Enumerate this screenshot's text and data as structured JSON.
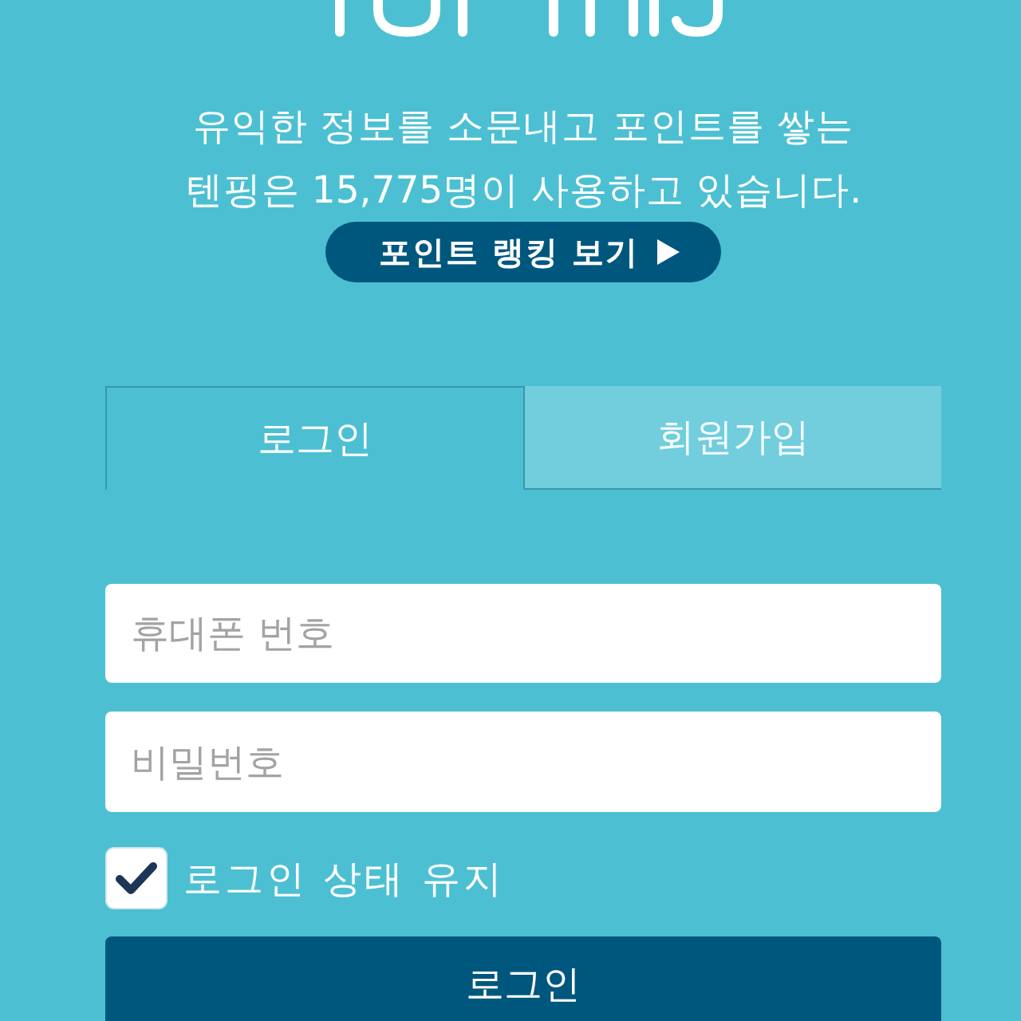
{
  "intro": {
    "text": "유익한 정보를 소문내고 포인트를 쌓는\n텐핑은 15,775명이 사용하고 있습니다.",
    "ranking_button": {
      "label": "포인트 랭킹 보기"
    }
  },
  "tabs": [
    {
      "label": "로그인",
      "selected": true
    },
    {
      "label": "회원가입",
      "selected": false
    }
  ],
  "fields": [
    {
      "placeholder": "휴대폰 번호"
    },
    {
      "placeholder": "비밀번호"
    }
  ],
  "remember": {
    "label": "로그인 상태 유지",
    "checked": true
  },
  "login_button": {
    "label": "로그인"
  }
}
